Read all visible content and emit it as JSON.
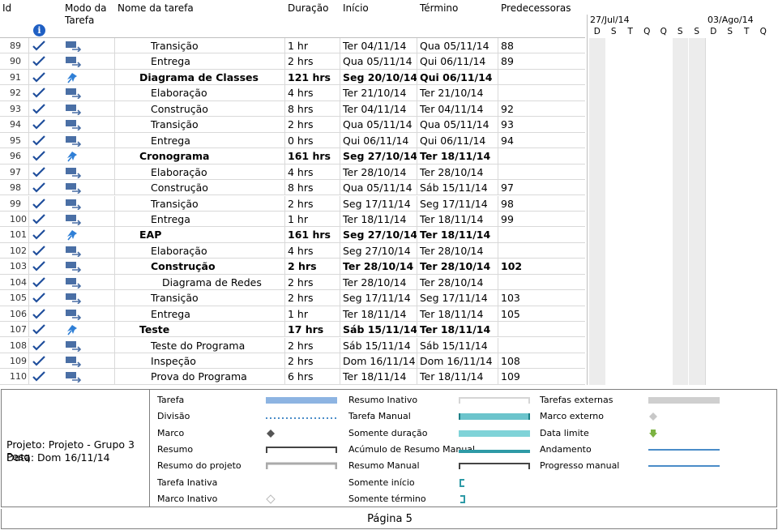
{
  "columns": {
    "id": "Id",
    "mode_line1": "Modo da",
    "mode_line2": "Tarefa",
    "name": "Nome da tarefa",
    "duration": "Duração",
    "start": "Início",
    "finish": "Término",
    "predecessors": "Predecessoras",
    "info_icon": "i"
  },
  "timeline": {
    "week1": "27/Jul/14",
    "week2": "03/Ago/14",
    "days": [
      "D",
      "S",
      "T",
      "Q",
      "Q",
      "S",
      "S",
      "D",
      "S",
      "T",
      "Q"
    ]
  },
  "tasks": [
    {
      "id": "89",
      "name": "Transição",
      "duration": "1 hr",
      "start": "Ter 04/11/14",
      "finish": "Qua 05/11/14",
      "pred": "88",
      "summary": false,
      "indent": 2
    },
    {
      "id": "90",
      "name": "Entrega",
      "duration": "2 hrs",
      "start": "Qua 05/11/14",
      "finish": "Qui 06/11/14",
      "pred": "89",
      "summary": false,
      "indent": 2
    },
    {
      "id": "91",
      "name": "Diagrama de Classes",
      "duration": "121 hrs",
      "start": "Seg 20/10/14",
      "finish": "Qui 06/11/14",
      "pred": "",
      "summary": true,
      "indent": 1
    },
    {
      "id": "92",
      "name": "Elaboração",
      "duration": "4 hrs",
      "start": "Ter 21/10/14",
      "finish": "Ter 21/10/14",
      "pred": "",
      "summary": false,
      "indent": 2
    },
    {
      "id": "93",
      "name": "Construção",
      "duration": "8 hrs",
      "start": "Ter 04/11/14",
      "finish": "Ter 04/11/14",
      "pred": "92",
      "summary": false,
      "indent": 2
    },
    {
      "id": "94",
      "name": "Transição",
      "duration": "2 hrs",
      "start": "Qua 05/11/14",
      "finish": "Qua 05/11/14",
      "pred": "93",
      "summary": false,
      "indent": 2
    },
    {
      "id": "95",
      "name": "Entrega",
      "duration": "0 hrs",
      "start": "Qui 06/11/14",
      "finish": "Qui 06/11/14",
      "pred": "94",
      "summary": false,
      "indent": 2
    },
    {
      "id": "96",
      "name": "Cronograma",
      "duration": "161 hrs",
      "start": "Seg 27/10/14",
      "finish": "Ter 18/11/14",
      "pred": "",
      "summary": true,
      "indent": 0
    },
    {
      "id": "97",
      "name": "Elaboração",
      "duration": "4 hrs",
      "start": "Ter 28/10/14",
      "finish": "Ter 28/10/14",
      "pred": "",
      "summary": false,
      "indent": 2
    },
    {
      "id": "98",
      "name": "Construção",
      "duration": "8 hrs",
      "start": "Qua 05/11/14",
      "finish": "Sáb 15/11/14",
      "pred": "97",
      "summary": false,
      "indent": 2
    },
    {
      "id": "99",
      "name": "Transição",
      "duration": "2 hrs",
      "start": "Seg 17/11/14",
      "finish": "Seg 17/11/14",
      "pred": "98",
      "summary": false,
      "indent": 2
    },
    {
      "id": "100",
      "name": "Entrega",
      "duration": "1 hr",
      "start": "Ter 18/11/14",
      "finish": "Ter 18/11/14",
      "pred": "99",
      "summary": false,
      "indent": 2
    },
    {
      "id": "101",
      "name": "EAP",
      "duration": "161 hrs",
      "start": "Seg 27/10/14",
      "finish": "Ter 18/11/14",
      "pred": "",
      "summary": true,
      "indent": 0
    },
    {
      "id": "102",
      "name": "Elaboração",
      "duration": "4 hrs",
      "start": "Seg 27/10/14",
      "finish": "Ter 28/10/14",
      "pred": "",
      "summary": false,
      "indent": 2
    },
    {
      "id": "103",
      "name": "Construção",
      "duration": "2 hrs",
      "start": "Ter 28/10/14",
      "finish": "Ter 28/10/14",
      "pred": "102",
      "summary": true,
      "indent": 2
    },
    {
      "id": "104",
      "name": "Diagrama de Redes",
      "duration": "2 hrs",
      "start": "Ter 28/10/14",
      "finish": "Ter 28/10/14",
      "pred": "",
      "summary": false,
      "indent": 3
    },
    {
      "id": "105",
      "name": "Transição",
      "duration": "2 hrs",
      "start": "Seg 17/11/14",
      "finish": "Seg 17/11/14",
      "pred": "103",
      "summary": false,
      "indent": 2
    },
    {
      "id": "106",
      "name": "Entrega",
      "duration": "1 hr",
      "start": "Ter 18/11/14",
      "finish": "Ter 18/11/14",
      "pred": "105",
      "summary": false,
      "indent": 2
    },
    {
      "id": "107",
      "name": "Teste",
      "duration": "17 hrs",
      "start": "Sáb 15/11/14",
      "finish": "Ter 18/11/14",
      "pred": "",
      "summary": true,
      "indent": 0
    },
    {
      "id": "108",
      "name": "Teste do Programa",
      "duration": "2 hrs",
      "start": "Sáb 15/11/14",
      "finish": "Sáb 15/11/14",
      "pred": "",
      "summary": false,
      "indent": 2
    },
    {
      "id": "109",
      "name": "Inspeção",
      "duration": "2 hrs",
      "start": "Dom 16/11/14",
      "finish": "Dom 16/11/14",
      "pred": "108",
      "summary": false,
      "indent": 2
    },
    {
      "id": "110",
      "name": "Prova do Programa",
      "duration": "6 hrs",
      "start": "Ter 18/11/14",
      "finish": "Ter 18/11/14",
      "pred": "109",
      "summary": false,
      "indent": 2
    }
  ],
  "project": {
    "line1": "Projeto: Projeto - Grupo 3 Pesq",
    "line2": "Data: Dom 16/11/14"
  },
  "legend": {
    "col1": [
      "Tarefa",
      "Divisão",
      "Marco",
      "Resumo",
      "Resumo do projeto",
      "Tarefa Inativa",
      "Marco Inativo"
    ],
    "col2": [
      "Resumo Inativo",
      "Tarefa Manual",
      "Somente duração",
      "Acúmulo de Resumo Manual",
      "Resumo Manual",
      "Somente início",
      "Somente término"
    ],
    "col3": [
      "Tarefas externas",
      "Marco externo",
      "Data limite",
      "Andamento",
      "Progresso manual"
    ]
  },
  "footer": {
    "page": "Página 5"
  },
  "colors": {
    "task_bar": "#8db4e2",
    "manual_bar": "#6cc4cc",
    "progress_line": "#4a8cc8",
    "deadline": "#7cb342",
    "check": "#1f4e9c",
    "icon": "#4a6fa5"
  }
}
